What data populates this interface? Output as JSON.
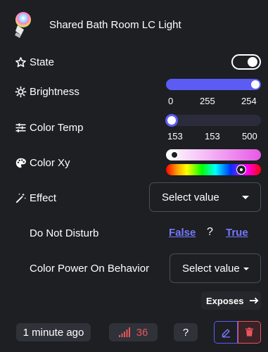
{
  "header": {
    "title": "Shared Bath Room LC Light",
    "icon": "bulb-icon"
  },
  "rows": {
    "state": {
      "label": "State",
      "icon": "star-icon",
      "value": true
    },
    "brightness": {
      "label": "Brightness",
      "icon": "sun-icon",
      "min": "0",
      "mid": "255",
      "max": "254",
      "value": 254,
      "range_max": 254
    },
    "color_temp": {
      "label": "Color Temp",
      "icon": "sliders-icon",
      "min": "153",
      "mid": "153",
      "max": "500",
      "value": 153,
      "range_min": 153,
      "range_max": 500
    },
    "color_xy": {
      "label": "Color Xy",
      "icon": "palette-icon"
    },
    "effect": {
      "label": "Effect",
      "icon": "magic-wand-icon",
      "select_value": "Select value"
    },
    "do_not_disturb": {
      "label": "Do Not Disturb",
      "false_label": "False",
      "question": "?",
      "true_label": "True"
    },
    "power_on": {
      "label": "Color Power On Behavior",
      "select_value": "Select value"
    }
  },
  "exposes": {
    "label": "Exposes"
  },
  "footer": {
    "last_seen": "1 minute ago",
    "lqi": "36",
    "unknown": "?"
  },
  "colors": {
    "accent": "#5c5cf5",
    "link": "#7578ff",
    "danger": "#e8555e",
    "background": "#1d1f23"
  }
}
